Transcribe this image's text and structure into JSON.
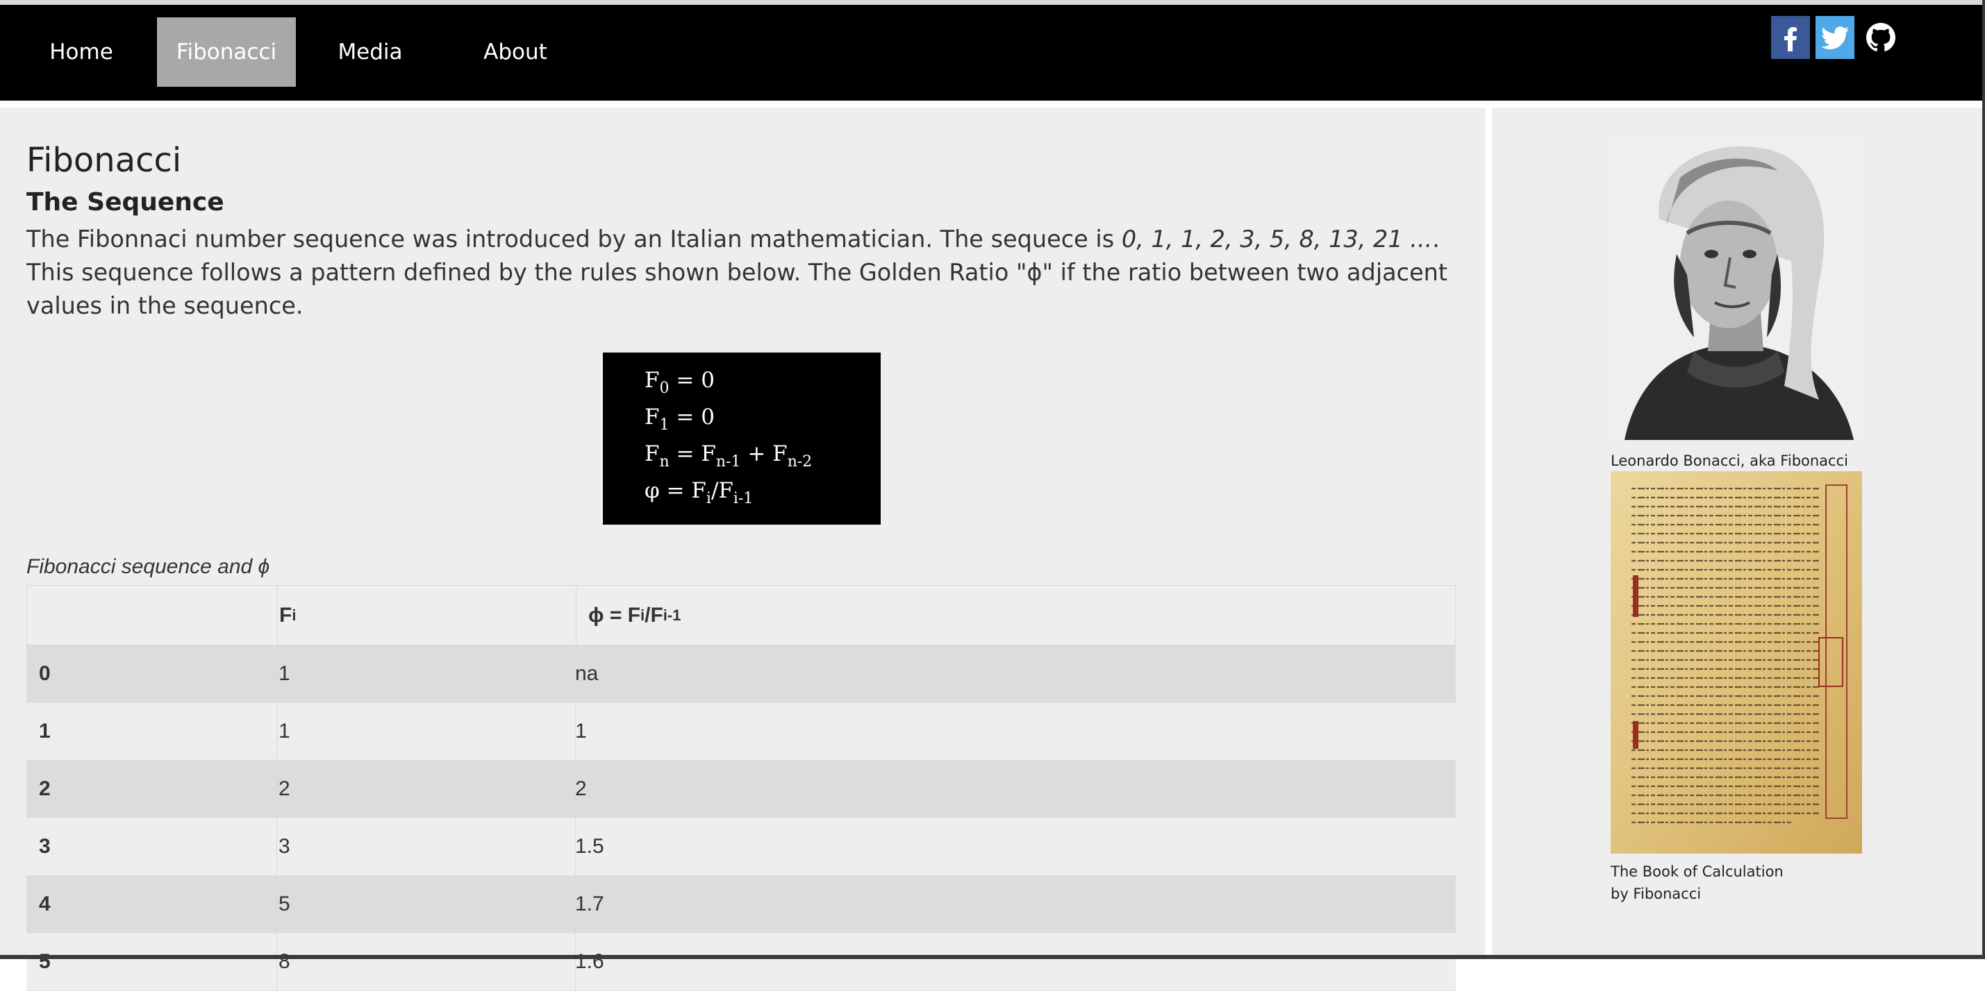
{
  "nav": {
    "items": [
      {
        "label": "Home",
        "active": false
      },
      {
        "label": "Fibonacci",
        "active": true
      },
      {
        "label": "Media",
        "active": false
      },
      {
        "label": "About",
        "active": false
      }
    ],
    "social": [
      "facebook-icon",
      "twitter-icon",
      "github-icon"
    ]
  },
  "main": {
    "title": "Fibonacci",
    "subtitle": "The Sequence",
    "paragraph_part1": "The Fibonnaci number sequence was introduced by an Italian mathematician. The sequece is ",
    "paragraph_italic": "0, 1, 1, 2, 3, 5, 8, 13, 21 ...",
    "paragraph_part2": ". This sequence follows a pattern defined by the rules shown below. The Golden Ratio \"ɸ\" if the ratio between two adjacent values in the sequence.",
    "formulas": {
      "f0": {
        "base": "F",
        "sub": "0",
        "rest": " = 0"
      },
      "f1": {
        "base": "F",
        "sub": "1",
        "rest": " = 0"
      },
      "fn": {
        "base": "F",
        "sub": "n",
        "eq": " = F",
        "sub2": "n-1",
        "plus": " + F",
        "sub3": "n-2"
      },
      "phi": {
        "base": "φ = F",
        "sub": "i",
        "mid": "/F",
        "sub2": "i-1"
      }
    },
    "table_caption": "Fibonacci sequence and ϕ",
    "table": {
      "headers": {
        "c1_base": "F",
        "c1_sub": "i",
        "c2_base": "ɸ = F",
        "c2_sub": "i",
        "c2_mid": "/F",
        "c2_sub2": "i-1"
      },
      "rows": [
        [
          "0",
          "1",
          "na"
        ],
        [
          "1",
          "1",
          "1"
        ],
        [
          "2",
          "2",
          "2"
        ],
        [
          "3",
          "3",
          "1.5"
        ],
        [
          "4",
          "5",
          "1.7"
        ],
        [
          "5",
          "8",
          "1.6"
        ]
      ]
    }
  },
  "side": {
    "portrait_caption": "Leonardo Bonacci, aka Fibonacci",
    "manuscript_caption_line1": "The Book of Calculation",
    "manuscript_caption_line2": "by Fibonacci"
  }
}
